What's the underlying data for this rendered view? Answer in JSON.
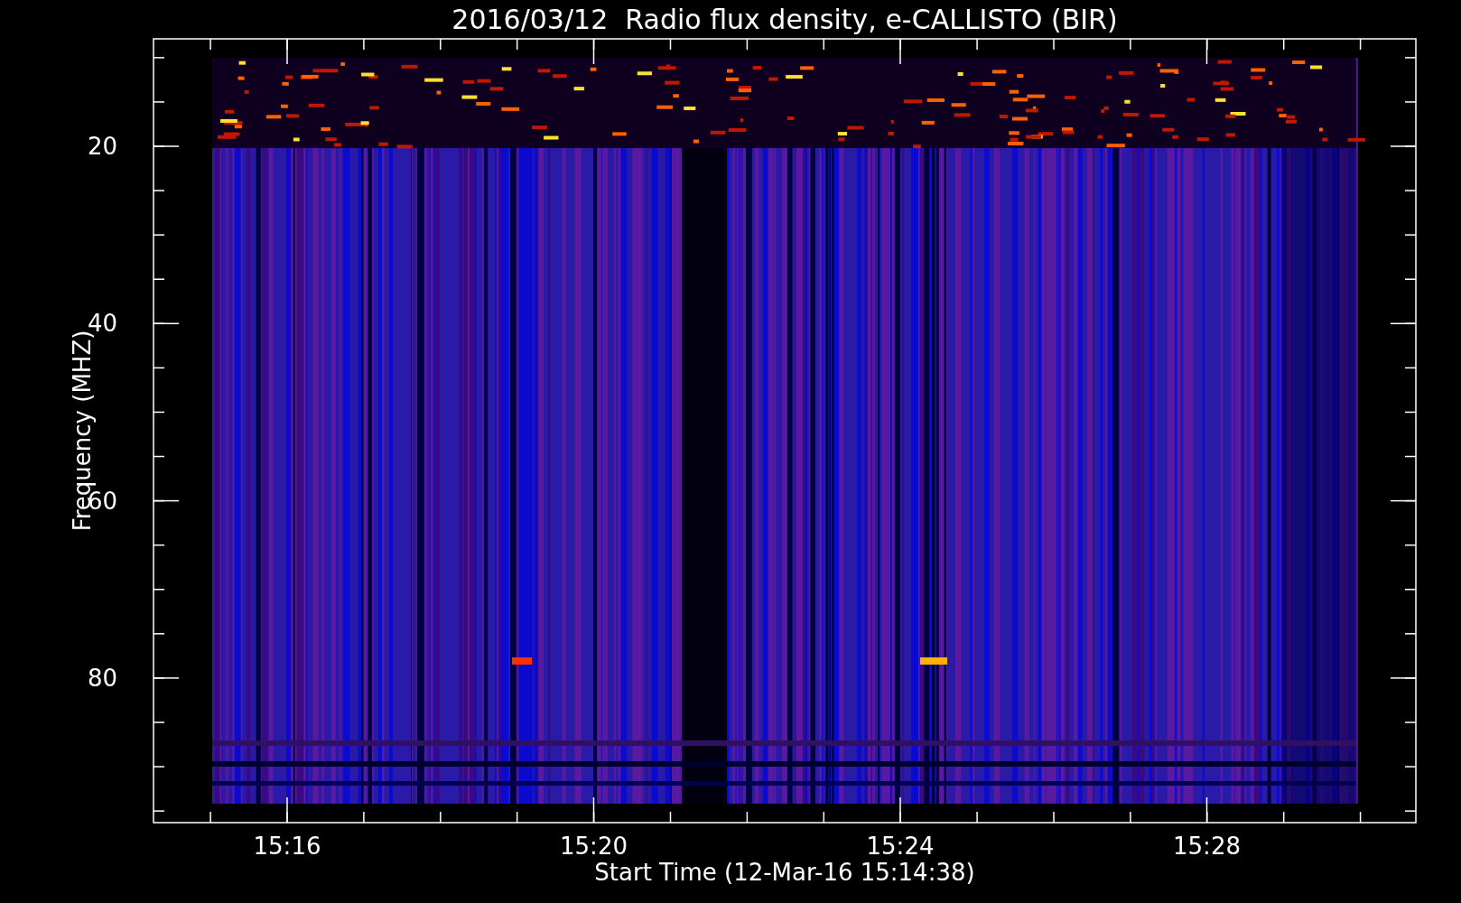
{
  "title": "2016/03/12  Radio flux density, e-CALLISTO (BIR)",
  "y_axis": {
    "label": "Frequency (MHZ)",
    "ticks": [
      "20",
      "40",
      "60",
      "80"
    ]
  },
  "x_axis": {
    "label": "Start Time (12-Mar-16 15:14:38)",
    "ticks": [
      "15:16",
      "15:20",
      "15:24",
      "15:28"
    ]
  }
}
